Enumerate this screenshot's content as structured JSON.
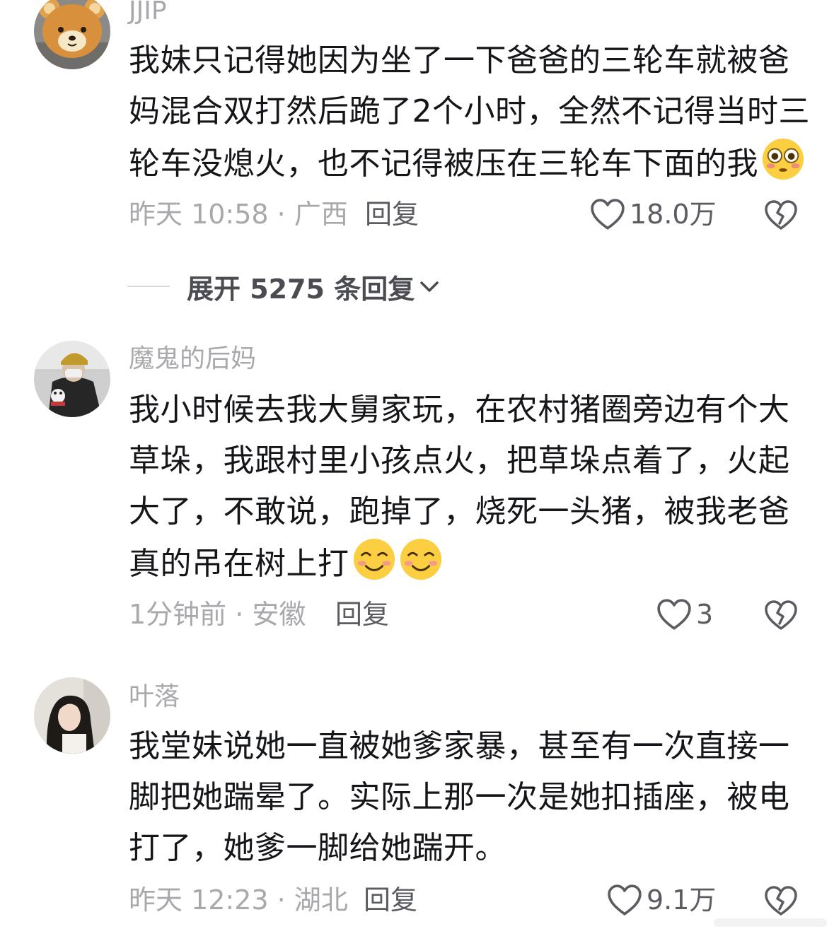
{
  "comments": [
    {
      "username": "JJIP",
      "lines": [
        "我妹只记得她因为坐了一下爸爸的三轮车就被爸",
        "妈混合双打然后跪了2个小时，全然不记得当时三",
        "轮车没熄火，也不记得被压在三轮车下面的我"
      ],
      "emojis": [
        "flushed-face-emoji"
      ],
      "time_location": "昨天 10:58 · 广西",
      "reply_label": "回复",
      "like_count": "18.0万"
    },
    {
      "username": "魔鬼的后妈",
      "lines": [
        "我小时候去我大舅家玩，在农村猪圈旁边有个大",
        "草垛，我跟村里小孩点火，把草垛点着了，火起",
        "大了，不敢说，跑掉了，烧死一头猪，被我老爸",
        "真的吊在树上打"
      ],
      "emojis": [
        "smiling-face-emoji",
        "smiling-face-emoji"
      ],
      "time_location": "1分钟前 · 安徽",
      "reply_label": "回复",
      "like_count": "3"
    },
    {
      "username": "叶落",
      "lines": [
        "我堂妹说她一直被她爹家暴，甚至有一次直接一",
        "脚把她踹晕了。实际上那一次是她扣插座，被电",
        "打了，她爹一脚给她踹开。"
      ],
      "time_location": "昨天 12:23 · 湖北",
      "reply_label": "回复",
      "like_count": "9.1万"
    }
  ],
  "expand_replies": {
    "label": "展开 5275 条回复"
  },
  "icons": {
    "like": "heart-outline-icon",
    "dislike": "broken-heart-icon",
    "expand": "chevron-down-icon"
  },
  "colors": {
    "text_primary": "#15161a",
    "text_secondary": "#a8a8ad",
    "action_text": "#5b5c62",
    "background": "#ffffff"
  }
}
